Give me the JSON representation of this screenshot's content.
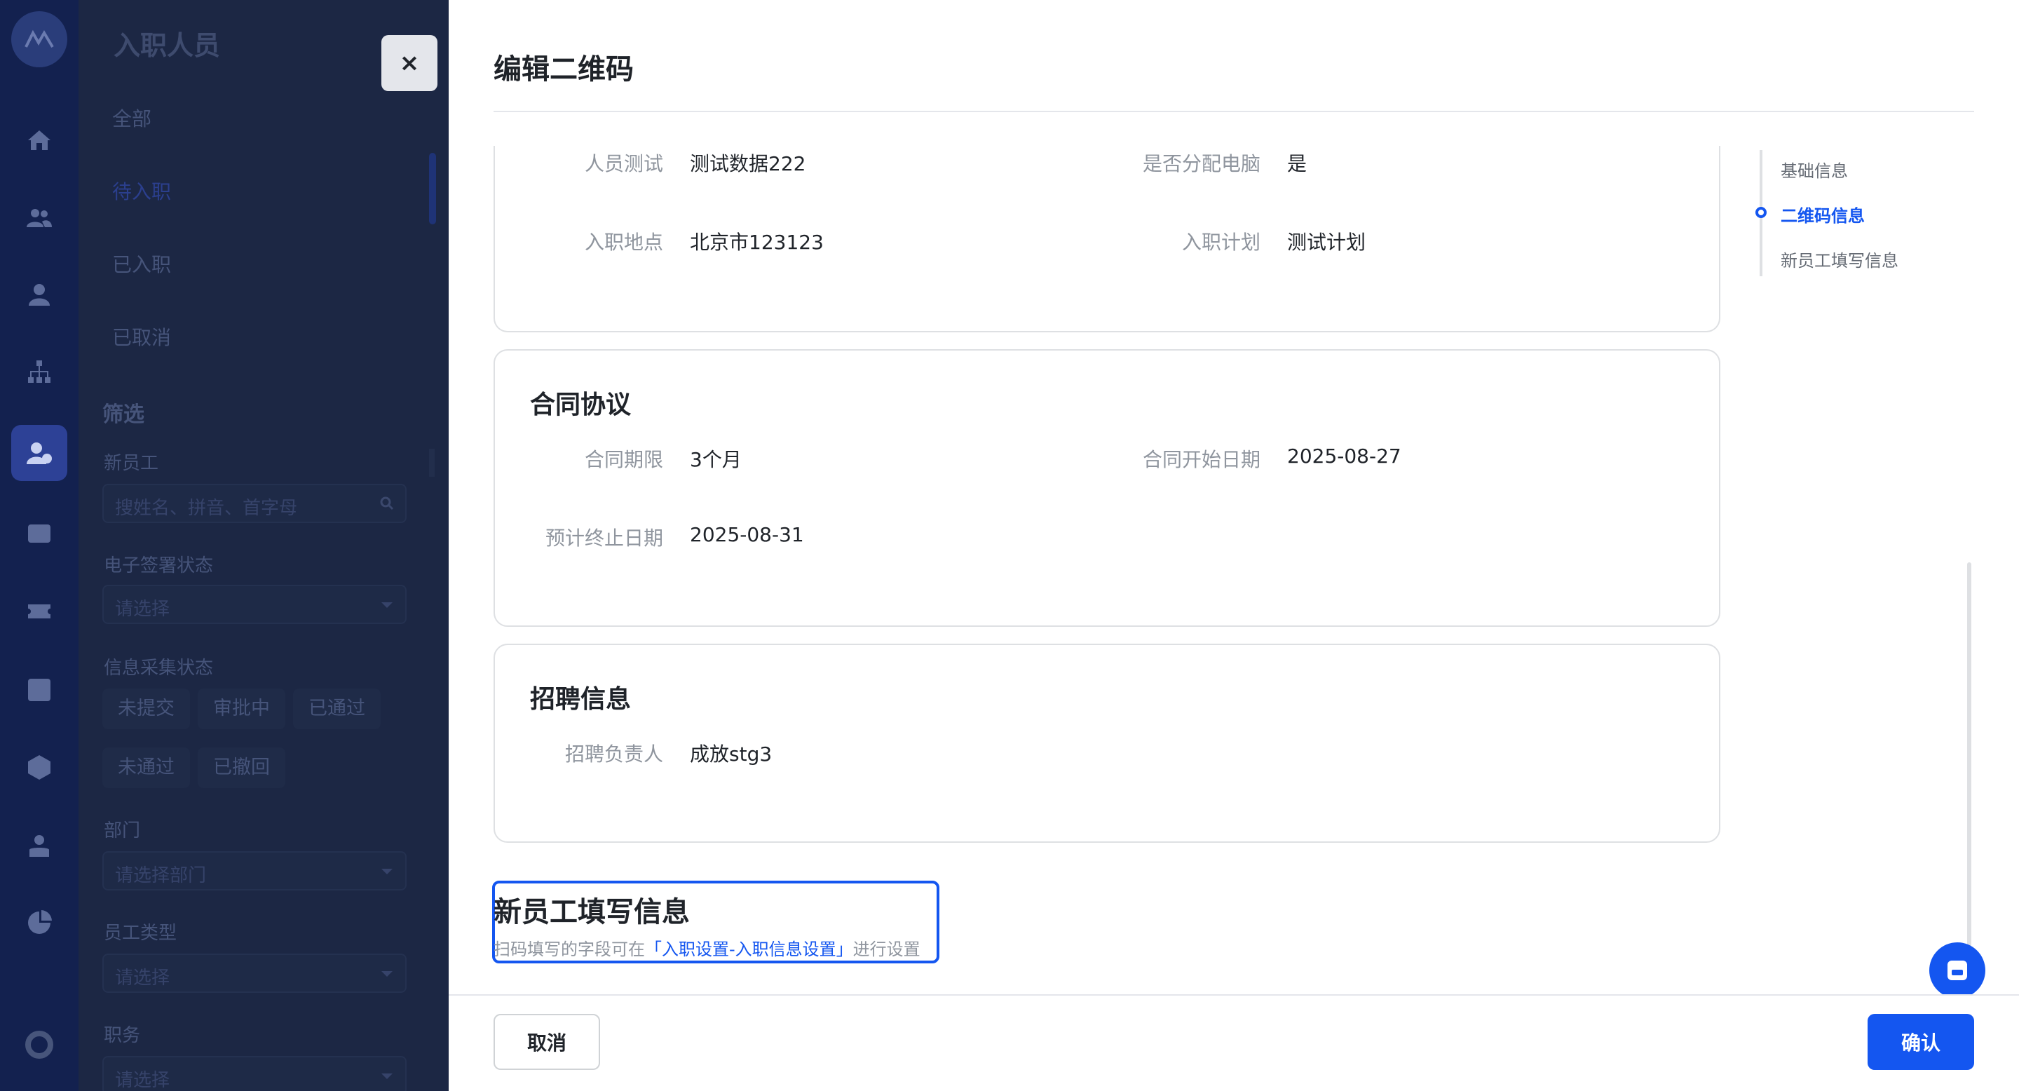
{
  "background": {
    "list_title": "入职人员",
    "tabs": [
      {
        "label": "全部"
      },
      {
        "label": "待入职"
      },
      {
        "label": "已入职"
      },
      {
        "label": "已取消"
      }
    ],
    "filter": {
      "heading": "筛选",
      "new_employee_label": "新员工",
      "search_placeholder": "搜姓名、拼音、首字母",
      "esign_status_label": "电子签署状态",
      "esign_status_value": "请选择",
      "info_status_label": "信息采集状态",
      "info_status_chips": [
        "未提交",
        "审批中",
        "已通过",
        "未通过",
        "已撤回"
      ],
      "department_label": "部门",
      "department_value": "请选择部门",
      "employee_type_label": "员工类型",
      "employee_type_value": "请选择",
      "position_label": "职务",
      "position_value": "请选择"
    }
  },
  "drawer": {
    "title": "编辑二维码",
    "close_glyph": "×",
    "basic_card": {
      "fields": [
        {
          "label": "人员测试",
          "value": "测试数据222"
        },
        {
          "label": "是否分配电脑",
          "value": "是"
        },
        {
          "label": "入职地点",
          "value": "北京市123123"
        },
        {
          "label": "入职计划",
          "value": "测试计划"
        }
      ]
    },
    "contract_card": {
      "title": "合同协议",
      "fields": [
        {
          "label": "合同期限",
          "value": "3个月"
        },
        {
          "label": "合同开始日期",
          "value": "2025-08-27"
        },
        {
          "label": "预计终止日期",
          "value": "2025-08-31"
        }
      ]
    },
    "recruit_card": {
      "title": "招聘信息",
      "fields": [
        {
          "label": "招聘负责人",
          "value": "成放stg3"
        }
      ]
    },
    "fill_section": {
      "title": "新员工填写信息",
      "hint_prefix": "扫码填写的字段可在",
      "hint_link": "「入职设置-入职信息设置」",
      "hint_suffix": "进行设置"
    },
    "anchors": [
      {
        "label": "基础信息",
        "active": false
      },
      {
        "label": "二维码信息",
        "active": true
      },
      {
        "label": "新员工填写信息",
        "active": false
      }
    ],
    "footer": {
      "cancel_label": "取消",
      "confirm_label": "确认"
    }
  },
  "colors": {
    "primary": "#1456f0",
    "overlay_rail": "#13214f",
    "overlay_panel": "#1c2744",
    "label_gray": "#8f959e",
    "border": "#dee0e3"
  }
}
